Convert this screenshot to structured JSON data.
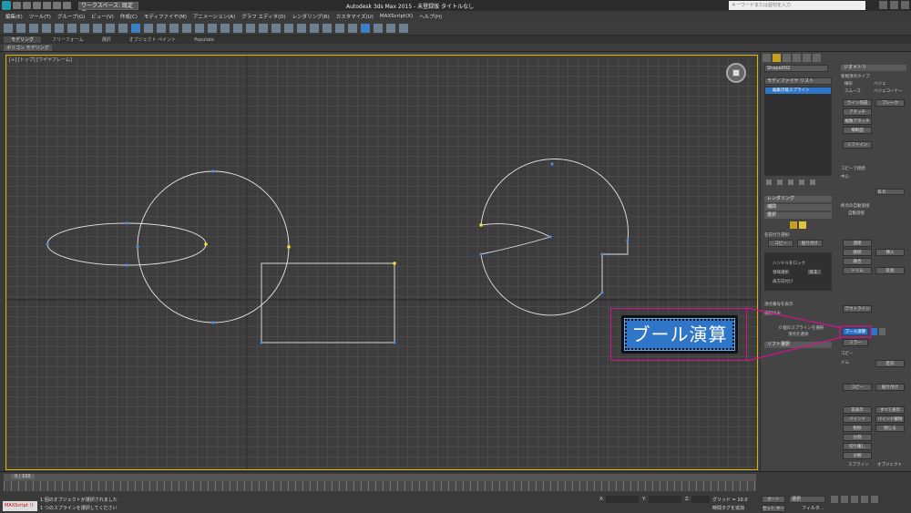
{
  "window": {
    "title": "Autodesk 3ds Max  2015  -  未登録版   タイトルなし",
    "workspace": "ワークスペース: 既定値",
    "search_placeholder": "キーワードまたは語句を入力"
  },
  "menu": [
    "編集(E)",
    "ツール(T)",
    "グループ(G)",
    "ビュー(V)",
    "作成(C)",
    "モディファイヤ(M)",
    "アニメーション(A)",
    "グラフ エディタ(D)",
    "レンダリング(R)",
    "カスタマイズ(U)",
    "MAXScript(X)",
    "ヘルプ(H)"
  ],
  "ribbon": {
    "tabs": [
      "モデリング",
      "フリーフォーム",
      "選択",
      "オブジェクト ペイント",
      "Populate"
    ],
    "active_tab": "モデリング",
    "sub_label": "ポリゴン モデリング"
  },
  "viewport": {
    "label": "[+] [トップ] [ワイヤフレーム]"
  },
  "command_panel": {
    "object_name": "Shape002",
    "modifier_list": "モディファイヤ リスト",
    "stack_item": "編集可能スプライン",
    "rollouts": {
      "rendering": "レンダリング",
      "interpolation": "補間",
      "selection": "選択",
      "geometry": "ジオメトリ",
      "soft_selection": "ソフト選択"
    },
    "new_vertex_type": "新規頂点タイプ",
    "vertex_types": [
      "線形",
      "ベジェ",
      "スムーズ",
      "ベジェコーナー"
    ],
    "geometry_buttons": [
      "ライン作成",
      "ブレーク",
      "アタッチ",
      "複数アタッチ",
      "横断面",
      "リファイン",
      "溶接",
      "接続",
      "挿入",
      "融合",
      "トリム",
      "延長",
      "アウトライン",
      "ブール演算",
      "ミラー",
      "コピー",
      "ドム",
      "区切"
    ],
    "named_selections": "名前付き選択:",
    "copy_label": "コピー",
    "paste_label": "貼り付け",
    "reorient": "再方向付け",
    "show_vertex_numbers": "頂点番号を表示",
    "selected_only": "選択のみ",
    "spline_selected": "0 個のスプラインを選択",
    "vertex_selected": "頂点を選択",
    "automatic_welding": "自動溶接",
    "threshold_value": "6.0",
    "center_label": "中心",
    "lock_handles": "ハンドルをロック",
    "area_selection": "領域選択",
    "weld_value": "0.1",
    "connect_copy": "コピーで接続",
    "end_point_auto": "終点の自動溶接",
    "spline_label": "スプライン",
    "object_label": "オブジェクト",
    "explode": "分解",
    "detach": "切り離し",
    "hide": "非表示",
    "unhide_all": "すべて表示",
    "bind": "バインド",
    "unbind": "バインド解除",
    "delete": "削除",
    "close": "閉じる",
    "divide": "分割",
    "cycle": "サイクル"
  },
  "callout": {
    "button_label": "ブール演算",
    "color": "#d6118d"
  },
  "status": {
    "maxscript": "MAXScript リ",
    "line1": "1 個のオブジェクトが選択されました",
    "line2": "1 つのスプラインを選択してください",
    "time": "0 / 100",
    "grid": "グリッド = 10.0",
    "time_tag": "時間タグを追加",
    "x": "X:",
    "y": "Y:",
    "z": "Z:",
    "auto": "オート",
    "set_key": "セット キー",
    "selected": "選択",
    "filter": "フィルタ..."
  }
}
